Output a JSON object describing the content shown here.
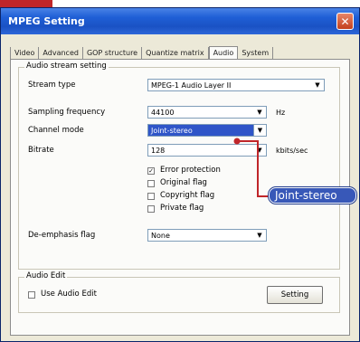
{
  "window": {
    "title": "MPEG Setting",
    "close_glyph": "✕"
  },
  "tabs": [
    {
      "label": "Video"
    },
    {
      "label": "Advanced"
    },
    {
      "label": "GOP structure"
    },
    {
      "label": "Quantize matrix"
    },
    {
      "label": "Audio",
      "active": true
    },
    {
      "label": "System"
    }
  ],
  "audio_stream": {
    "group_title": "Audio stream setting",
    "stream_type": {
      "label": "Stream type",
      "value": "MPEG-1 Audio Layer II"
    },
    "sampling_frequency": {
      "label": "Sampling frequency",
      "value": "44100",
      "unit": "Hz"
    },
    "channel_mode": {
      "label": "Channel mode",
      "value": "Joint-stereo"
    },
    "bitrate": {
      "label": "Bitrate",
      "value": "128",
      "unit": "kbits/sec"
    },
    "flags": [
      {
        "label": "Error protection",
        "checked": true
      },
      {
        "label": "Original flag",
        "checked": false
      },
      {
        "label": "Copyright flag",
        "checked": false
      },
      {
        "label": "Private flag",
        "checked": false
      }
    ],
    "de_emphasis": {
      "label": "De-emphasis flag",
      "value": "None"
    }
  },
  "audio_edit": {
    "group_title": "Audio Edit",
    "use_label": "Use Audio Edit",
    "use_checked": false,
    "setting_button": "Setting"
  },
  "callout": {
    "text": "Joint-stereo"
  },
  "colors": {
    "titlebar": "#1f5fd6",
    "selection": "#2f55c8",
    "callout": "#3858b8",
    "leader": "#c0262a",
    "brand_tab": "#c0262a"
  },
  "icons": {
    "dropdown_arrow": "chevron-down-icon",
    "check": "check-icon",
    "close": "close-icon"
  }
}
